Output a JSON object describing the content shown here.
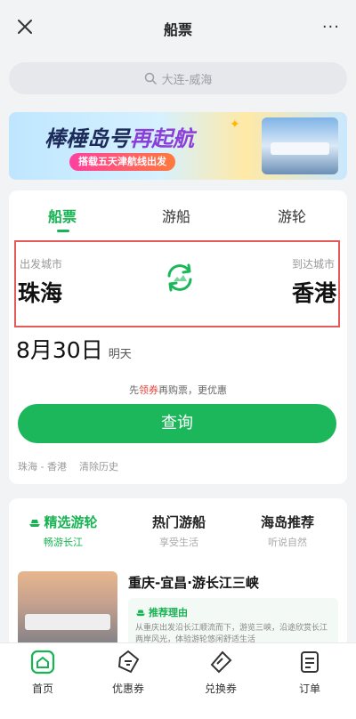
{
  "topbar": {
    "title": "船票",
    "more": "···"
  },
  "search": {
    "placeholder": "大连-威海"
  },
  "banner": {
    "headline_a": "棒棰岛号",
    "headline_b": "再起航",
    "sub": "搭载五天津航线出发"
  },
  "tabs": [
    {
      "label": "船票"
    },
    {
      "label": "游船"
    },
    {
      "label": "游轮"
    }
  ],
  "route": {
    "from_label": "出发城市",
    "from_city": "珠海",
    "to_label": "到达城市",
    "to_city": "香港"
  },
  "date": {
    "value": "8月30日",
    "weekday": "明天"
  },
  "hint": {
    "pre": "先",
    "hl": "领券",
    "post": "再购票，更优惠"
  },
  "query": {
    "label": "查询"
  },
  "history": [
    "珠海 - 香港",
    "清除历史"
  ],
  "sections": [
    {
      "title": "精选游轮",
      "sub": "畅游长江"
    },
    {
      "title": "热门游船",
      "sub": "享受生活"
    },
    {
      "title": "海岛推荐",
      "sub": "听说自然"
    }
  ],
  "cruise": {
    "title": "重庆-宜昌·游长江三峡",
    "badge": "推荐理由",
    "desc": "从重庆出发沿长江顺流而下，游览三峡，沿途欣赏长江两岸风光，体验游轮悠闲舒适生活"
  },
  "nav": [
    {
      "label": "首页"
    },
    {
      "label": "优惠券"
    },
    {
      "label": "兑换券"
    },
    {
      "label": "订单"
    }
  ],
  "colors": {
    "accent": "#1cb75a",
    "highlight": "#e0453a",
    "border": "#e45a5a"
  }
}
